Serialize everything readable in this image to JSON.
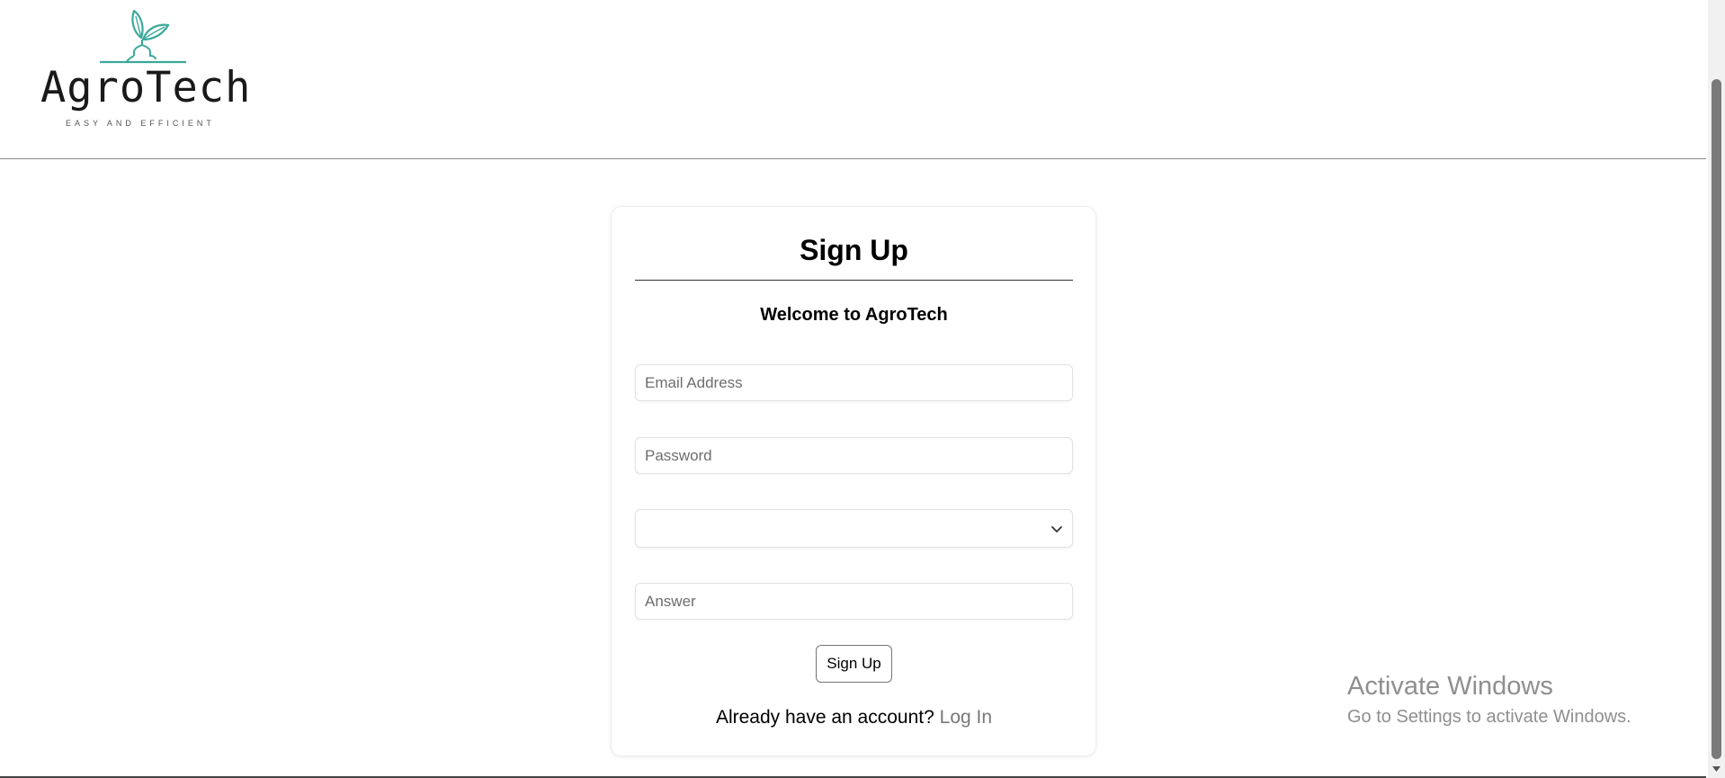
{
  "header": {
    "logo": {
      "name": "AgroTech",
      "tagline": "EASY AND EFFICIENT",
      "icon": "sprout-icon",
      "color": "#3aa99a"
    }
  },
  "signup_form": {
    "title": "Sign Up",
    "subtitle": "Welcome to AgroTech",
    "email": {
      "value": "",
      "placeholder": "Email Address"
    },
    "password": {
      "value": "",
      "placeholder": "Password"
    },
    "security_question": {
      "selected": "",
      "icon": "chevron-down-icon"
    },
    "answer": {
      "value": "",
      "placeholder": "Answer"
    },
    "submit_label": "Sign Up",
    "login_prompt": "Already have an account?",
    "login_link": "Log In"
  },
  "watermark": {
    "title": "Activate Windows",
    "subtitle": "Go to Settings to activate Windows."
  }
}
